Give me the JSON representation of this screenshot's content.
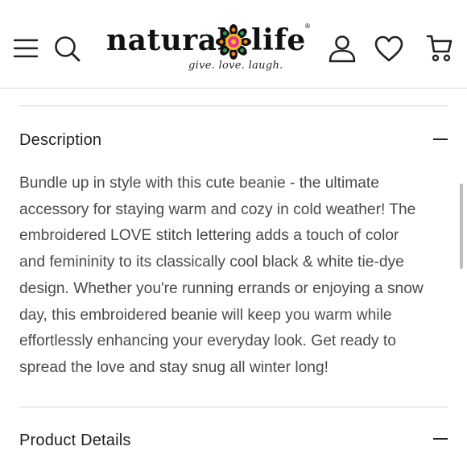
{
  "header": {
    "logo": {
      "word_left": "natural",
      "word_right": "life",
      "registered": "®",
      "tagline": "give. love. laugh."
    },
    "icons": [
      "menu-icon",
      "search-icon",
      "account-icon",
      "heart-icon",
      "cart-icon"
    ]
  },
  "description": {
    "title": "Description",
    "toggle": "minus-icon",
    "lines": [
      "Bundle up in style with this cute beanie - the ultimate",
      "accessory for staying warm and cozy in cold weather! The",
      "embroidered LOVE stitch lettering adds a touch of color",
      "and femininity to its classically cool black & white tie-dye",
      "design. Whether you're running errands or enjoying a snow",
      "day, this embroidered beanie will keep you warm while",
      "effortlessly enhancing your everyday look. Get ready to",
      "spread the love and stay snug all winter long!"
    ]
  },
  "product_details": {
    "title": "Product Details",
    "toggle": "minus-icon"
  },
  "colors": {
    "text": "#222222",
    "body_text": "#4a4a4a",
    "divider": "#d6d6d6",
    "flower_pink": "#e6358a",
    "flower_orange": "#f08a24",
    "flower_yellow": "#f4c21f",
    "flower_green": "#2f9e54"
  }
}
